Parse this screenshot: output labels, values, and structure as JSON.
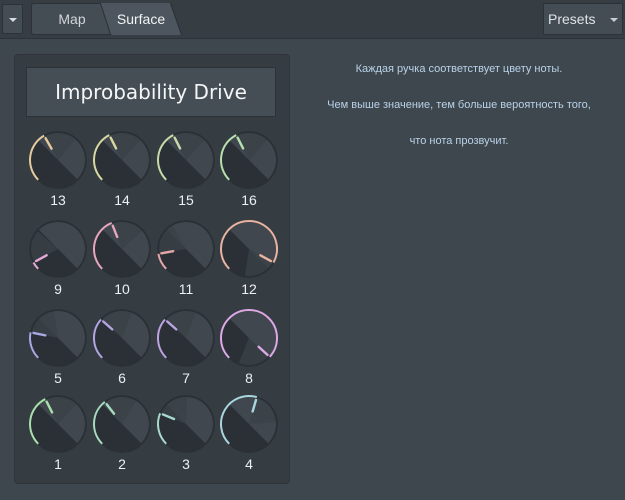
{
  "toolbar": {
    "menu_icon": "chevron-down-icon",
    "tabs": [
      {
        "label": "Map",
        "selected": false
      },
      {
        "label": "Surface",
        "selected": true
      }
    ],
    "presets_label": "Presets"
  },
  "panel": {
    "title": "Improbability Drive",
    "knobs": [
      {
        "label": "13",
        "value": 0.39,
        "color": "#e7c9a0"
      },
      {
        "label": "14",
        "value": 0.4,
        "color": "#d9d7a0"
      },
      {
        "label": "15",
        "value": 0.4,
        "color": "#c6dba8"
      },
      {
        "label": "16",
        "value": 0.4,
        "color": "#b7dfae"
      },
      {
        "label": "9",
        "value": 0.06,
        "color": "#e6a9d6"
      },
      {
        "label": "10",
        "value": 0.42,
        "color": "#e8a6bd"
      },
      {
        "label": "11",
        "value": 0.13,
        "color": "#e5a6a8"
      },
      {
        "label": "12",
        "value": 0.94,
        "color": "#e8b3a1"
      },
      {
        "label": "5",
        "value": 0.21,
        "color": "#a9a8e2"
      },
      {
        "label": "6",
        "value": 0.32,
        "color": "#b4a5e2"
      },
      {
        "label": "7",
        "value": 0.32,
        "color": "#bea3e2"
      },
      {
        "label": "8",
        "value": 0.99,
        "color": "#dda8e4"
      },
      {
        "label": "1",
        "value": 0.4,
        "color": "#a8e0ac"
      },
      {
        "label": "2",
        "value": 0.36,
        "color": "#a8dcc0"
      },
      {
        "label": "3",
        "value": 0.25,
        "color": "#a8d9cf"
      },
      {
        "label": "4",
        "value": 0.56,
        "color": "#a9d6de"
      }
    ]
  },
  "info": {
    "line1": "Каждая ручка соответствует цвету ноты.",
    "line2": "Чем выше значение, тем больше вероятность того,",
    "line3": "что нота прозвучит."
  }
}
